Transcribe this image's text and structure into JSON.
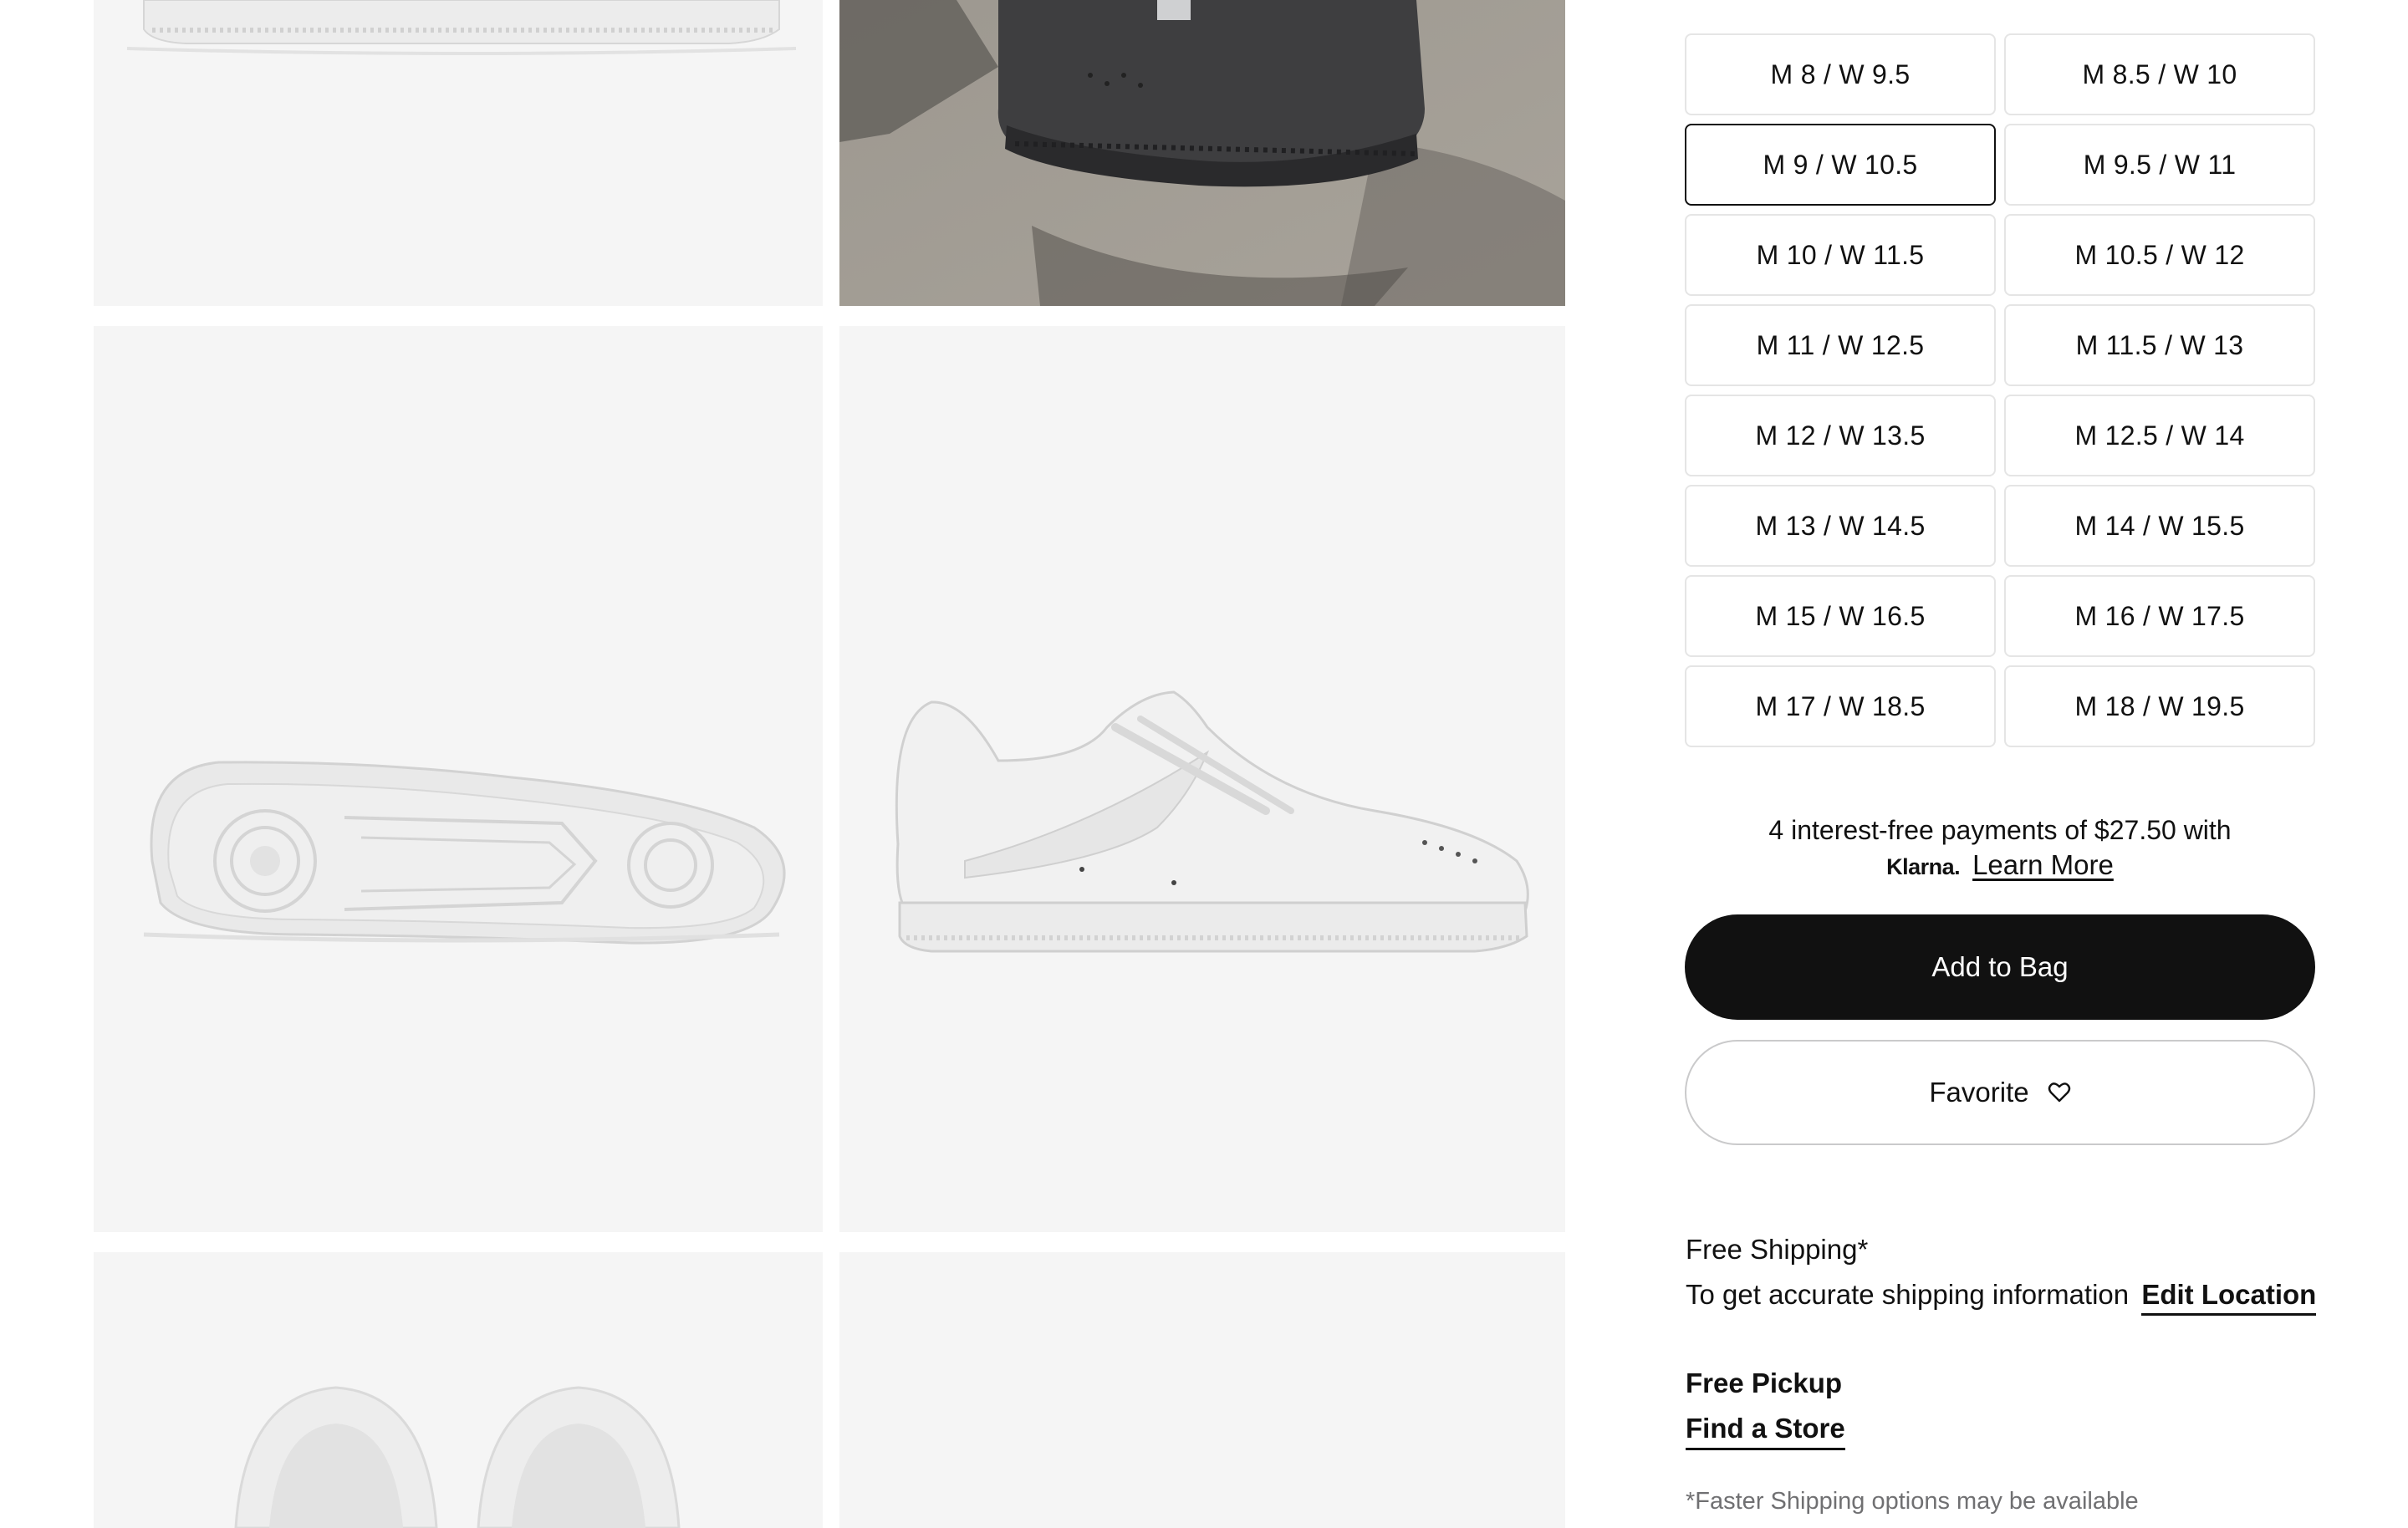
{
  "sizes": [
    {
      "label": "M 8 / W 9.5",
      "selected": false
    },
    {
      "label": "M 8.5 / W 10",
      "selected": false
    },
    {
      "label": "M 9 / W 10.5",
      "selected": true
    },
    {
      "label": "M 9.5 / W 11",
      "selected": false
    },
    {
      "label": "M 10 / W 11.5",
      "selected": false
    },
    {
      "label": "M 10.5 / W 12",
      "selected": false
    },
    {
      "label": "M 11 / W 12.5",
      "selected": false
    },
    {
      "label": "M 11.5 / W 13",
      "selected": false
    },
    {
      "label": "M 12 / W 13.5",
      "selected": false
    },
    {
      "label": "M 12.5 / W 14",
      "selected": false
    },
    {
      "label": "M 13 / W 14.5",
      "selected": false
    },
    {
      "label": "M 14 / W 15.5",
      "selected": false
    },
    {
      "label": "M 15 / W 16.5",
      "selected": false
    },
    {
      "label": "M 16 / W 17.5",
      "selected": false
    },
    {
      "label": "M 17 / W 18.5",
      "selected": false
    },
    {
      "label": "M 18 / W 19.5",
      "selected": false
    }
  ],
  "klarna": {
    "text": "4 interest-free payments of $27.50 with",
    "logo": "Klarna.",
    "link": "Learn More"
  },
  "actions": {
    "add_to_bag": "Add to Bag",
    "favorite": "Favorite",
    "favorite_icon": "heart-icon"
  },
  "shipping": {
    "heading": "Free Shipping*",
    "text": "To get accurate shipping information",
    "link": "Edit Location"
  },
  "pickup": {
    "heading": "Free Pickup",
    "link": "Find a Store"
  },
  "footnote": "*Faster Shipping options may be available",
  "colors": {
    "primary": "#111111",
    "tile_bg": "#f5f5f5",
    "border": "#e5e5e5",
    "muted": "#707072"
  }
}
